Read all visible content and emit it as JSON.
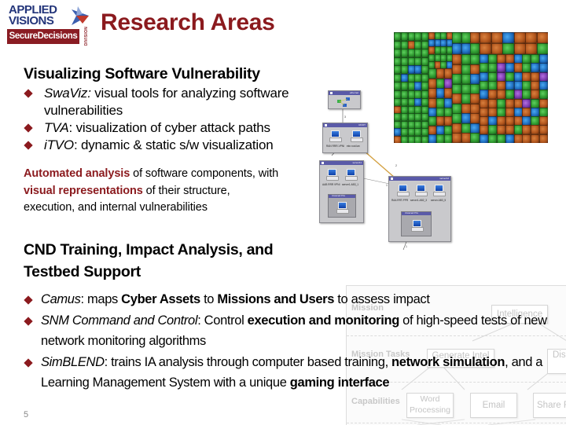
{
  "logo": {
    "line1": "APPLIED",
    "line2": "VISIONS",
    "banner": "SecureDecisions",
    "division": "DIVISION",
    "colors": {
      "navy": "#23357a",
      "red": "#8a1c23"
    }
  },
  "title": "Research Areas",
  "section1": {
    "heading": "Visualizing Software Vulnerability",
    "bullets": [
      {
        "name": "SwaViz",
        "name_suffix": ":",
        "text": " visual tools for analyzing software vulnerabilities"
      },
      {
        "name": "TVA",
        "name_suffix": ":",
        "text": " visualization of cyber attack paths"
      },
      {
        "name": "iTVO",
        "name_suffix": ":",
        "text": " dynamic & static s/w visualization"
      }
    ],
    "description": {
      "part1_highlight": "Automated analysis",
      "part2": " of software components, with ",
      "part3_highlight": "visual representations",
      "part4": " of their structure, execution, and internal vulnerabilities"
    }
  },
  "section2": {
    "heading": "CND Training, Impact Analysis, and Testbed Support",
    "bullets": [
      {
        "name": "Camus",
        "segments": [
          {
            "t": ": maps ",
            "b": false
          },
          {
            "t": "Cyber Assets",
            "b": true
          },
          {
            "t": " to ",
            "b": false
          },
          {
            "t": "Missions and Users",
            "b": true
          },
          {
            "t": " to assess impact",
            "b": false
          }
        ]
      },
      {
        "name": "SNM Command and Control",
        "segments": [
          {
            "t": ": Control ",
            "b": false
          },
          {
            "t": "execution and monitoring",
            "b": true
          },
          {
            "t": "  of high-speed tests of  new network monitoring algorithms",
            "b": false
          }
        ]
      },
      {
        "name": "SimBLEND",
        "segments": [
          {
            "t": ": trains IA analysis through computer based training, ",
            "b": false
          },
          {
            "t": "network simulation",
            "b": true
          },
          {
            "t": ", and a Learning Management System with a unique ",
            "b": false
          },
          {
            "t": "gaming interface",
            "b": true
          }
        ]
      }
    ]
  },
  "page_number": "5",
  "network_diagram": {
    "boxes": [
      {
        "title": "ethernet"
      },
      {
        "title": "ROOT"
      },
      {
        "title": "server11"
      },
      {
        "title": "server12"
      }
    ],
    "labels": [
      "RAN RRR-VPNI",
      "ekn.root.lan",
      "AAB RRR VPNI",
      "server1.AB3_1",
      "RAA RRT-PPR",
      "server1.AB2_3",
      "server.AB3_5",
      "Unnamed PCs"
    ],
    "edge_labels": [
      "3",
      "2",
      "1",
      "1"
    ]
  },
  "treemap": {
    "colors": {
      "green": "#2f9a30",
      "orange": "#b2561d",
      "blue": "#1f6fc0",
      "purple": "#7d3cb0"
    }
  },
  "mission_diagram": {
    "rows": [
      "Mission",
      "Mission Tasks",
      "Capabilities"
    ],
    "nodes": [
      "Intelligence",
      "Generate Intel",
      "Dis Inte",
      "Word Processing",
      "Email",
      "Share F"
    ]
  },
  "colors": {
    "accent": "#8b1a1e",
    "text": "#000000"
  }
}
